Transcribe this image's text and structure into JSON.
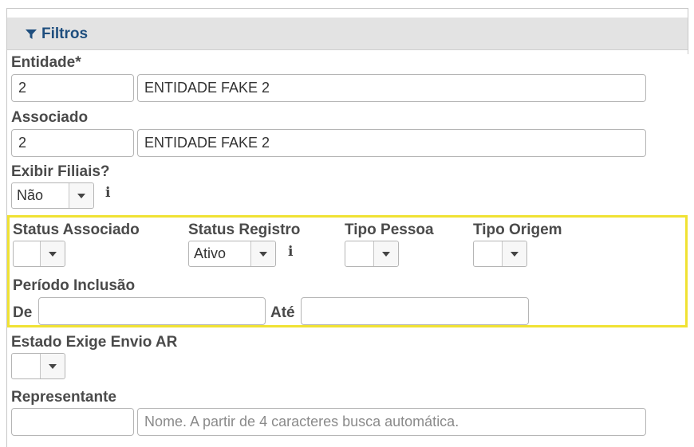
{
  "panel": {
    "title": "Filtros",
    "icon": "filter-icon"
  },
  "entidade": {
    "label": "Entidade*",
    "code": "2",
    "name": "ENTIDADE FAKE 2"
  },
  "associado": {
    "label": "Associado",
    "code": "2",
    "name": "ENTIDADE FAKE 2"
  },
  "exibir_filiais": {
    "label": "Exibir Filiais?",
    "value": "Não",
    "info_icon": "info-icon"
  },
  "status_associado": {
    "label": "Status Associado",
    "value": ""
  },
  "status_registro": {
    "label": "Status Registro",
    "value": "Ativo",
    "info_icon": "info-icon"
  },
  "tipo_pessoa": {
    "label": "Tipo Pessoa",
    "value": ""
  },
  "tipo_origem": {
    "label": "Tipo Origem",
    "value": ""
  },
  "periodo": {
    "label": "Período Inclusão",
    "de_label": "De",
    "ate_label": "Até",
    "de_value": "",
    "ate_value": ""
  },
  "estado_ar": {
    "label": "Estado Exige Envio AR",
    "value": ""
  },
  "representante": {
    "label": "Representante",
    "code": "",
    "placeholder": "Nome. A partir de 4 caracteres busca automática."
  },
  "colors": {
    "highlight": "#f0e233",
    "header_bg": "#e3e3e3",
    "title": "#1e4e7e"
  }
}
